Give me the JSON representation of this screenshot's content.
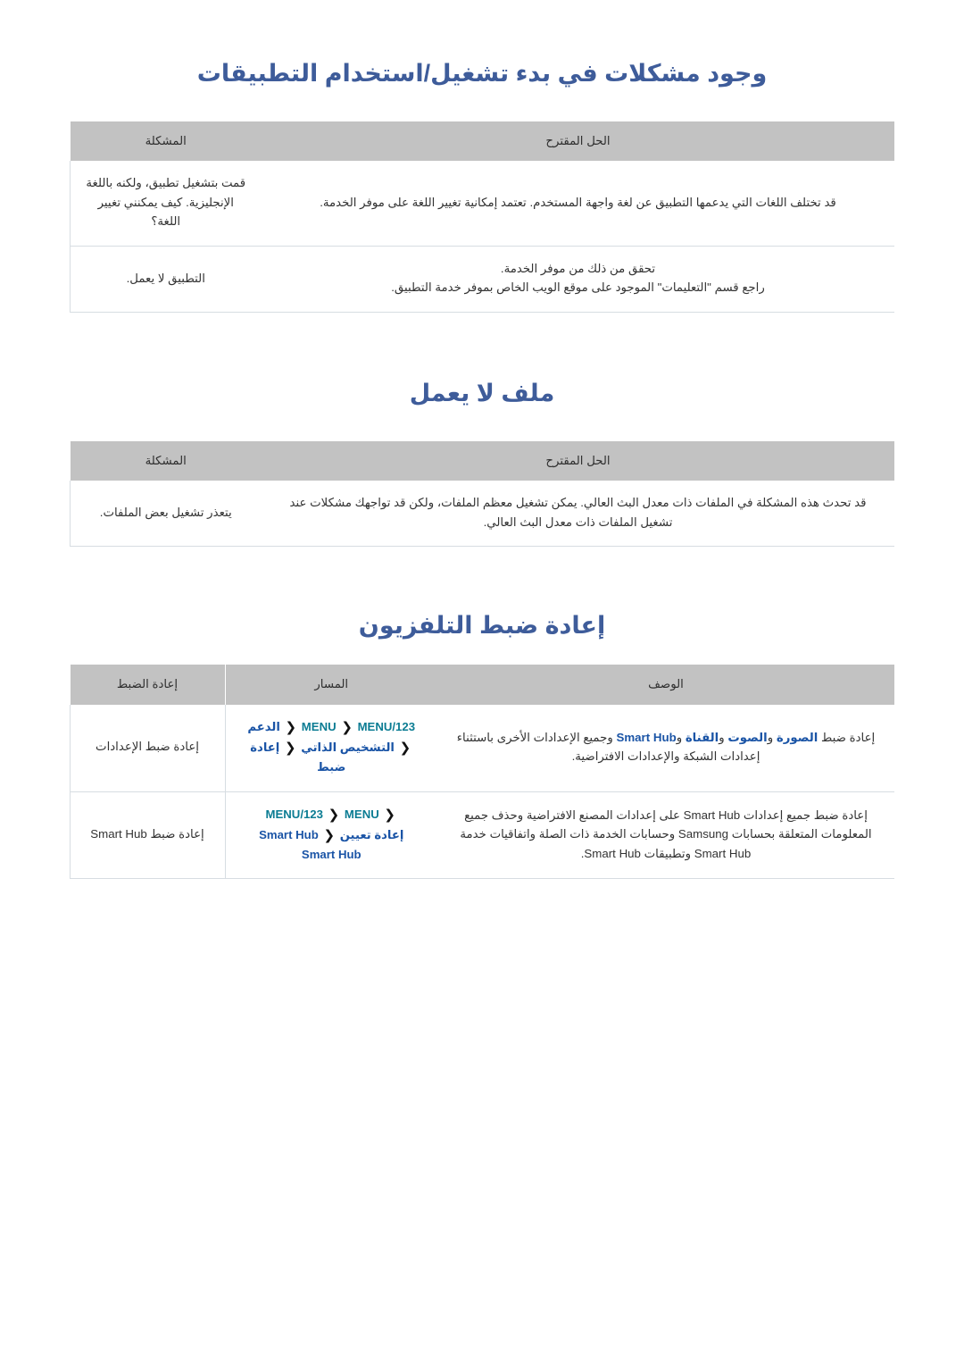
{
  "document": {
    "language": "ar",
    "direction": "rtl",
    "accent_heading_color": "#3e5c9a",
    "table_header_bg": "#c2c2c2",
    "menu_key_color": "#0b7c93",
    "menu_item_color": "#1a54a6"
  },
  "sections": [
    {
      "heading": "وجود مشكلات في بدء تشغيل/استخدام التطبيقات",
      "table": {
        "headers": [
          "الحل المقترح",
          "المشكلة"
        ],
        "rows": [
          {
            "solution": "قد تختلف اللغات التي يدعمها التطبيق عن لغة واجهة المستخدم. تعتمد إمكانية تغيير اللغة على موفر الخدمة.",
            "problem": "قمت بتشغيل تطبيق، ولكنه باللغة الإنجليزية. كيف يمكنني تغيير اللغة؟"
          },
          {
            "solution_line1": "تحقق من ذلك من موفر الخدمة.",
            "solution_line2": "راجع قسم \"التعليمات\" الموجود على موقع الويب الخاص بموفر خدمة التطبيق.",
            "problem": "التطبيق لا يعمل."
          }
        ]
      }
    },
    {
      "heading": "ملف لا يعمل",
      "table": {
        "headers": [
          "الحل المقترح",
          "المشكلة"
        ],
        "rows": [
          {
            "solution": "قد تحدث هذه المشكلة في الملفات ذات معدل البث العالي. يمكن تشغيل معظم الملفات، ولكن قد تواجهك مشكلات عند تشغيل الملفات ذات معدل البث العالي.",
            "problem": "يتعذر تشغيل بعض الملفات."
          }
        ]
      }
    },
    {
      "heading": "إعادة ضبط التلفزيون",
      "table": {
        "headers": [
          "الوصف",
          "المسار",
          "إعادة الضبط"
        ],
        "rows": [
          {
            "reset": "إعادة ضبط الإعدادات",
            "path": {
              "line1_keys": [
                "MENU/123",
                "MENU"
              ],
              "line1_item": "الدعم",
              "line2_items": [
                "التشخيص الذاتي",
                "إعادة ضبط"
              ],
              "full_text": "MENU/123 ❮ MENU ❮ الدعم ❮ التشخيص الذاتي ❮ إعادة ضبط"
            },
            "description": {
              "prefix": "إعادة ضبط ",
              "hl1": "الصورة",
              "mid1": " و",
              "hl2": "الصوت",
              "mid2": " و",
              "hl3": "القناة",
              "mid3": " و",
              "hl4": "Smart Hub",
              "suffix": " وجميع الإعدادات الأخرى باستثناء إعدادات الشبكة والإعدادات الافتراضية.",
              "full_text": "إعادة ضبط الصورة والصوت والقناة وSmart Hub وجميع الإعدادات الأخرى باستثناء إعدادات الشبكة والإعدادات الافتراضية."
            }
          },
          {
            "reset": "إعادة ضبط Smart Hub",
            "path": {
              "line1_keys": [
                "MENU/123",
                "MENU"
              ],
              "line2_item": "Smart Hub",
              "line2_item2": "إعادة تعيين",
              "line3_item": "Smart Hub",
              "full_text": "MENU/123 ❮ MENU ❮ Smart Hub ❮ إعادة تعيين Smart Hub"
            },
            "description": {
              "full_text": "إعادة ضبط جميع إعدادات Smart Hub على إعدادات المصنع الافتراضية وحذف جميع المعلومات المتعلقة بحسابات Samsung وحسابات الخدمة ذات الصلة واتفاقيات خدمة Smart Hub وتطبيقات Smart Hub."
            }
          }
        ]
      }
    }
  ]
}
